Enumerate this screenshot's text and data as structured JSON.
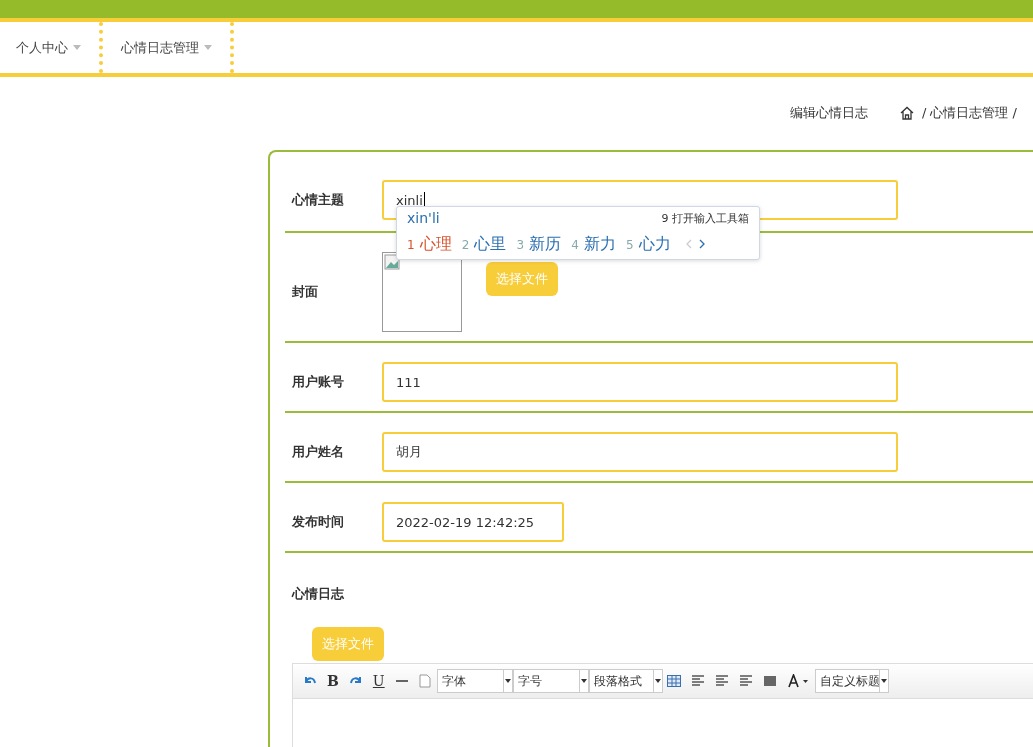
{
  "nav": [
    {
      "label": "个人中心"
    },
    {
      "label": "心情日志管理"
    }
  ],
  "breadcrumb": {
    "title": "编辑心情日志",
    "trail": "/ 心情日志管理 /"
  },
  "form": {
    "fields": [
      {
        "kind": "text",
        "label": "心情主题",
        "value": "xinli"
      },
      {
        "kind": "image",
        "label": "封面",
        "button": "选择文件"
      },
      {
        "kind": "text",
        "label": "用户账号",
        "value": "111"
      },
      {
        "kind": "text",
        "label": "用户姓名",
        "value": "胡月"
      },
      {
        "kind": "date",
        "label": "发布时间",
        "value": "2022-02-19 12:42:25"
      },
      {
        "kind": "editor",
        "label": "心情日志",
        "button": "选择文件",
        "marks": [
          "B",
          "U"
        ],
        "selects": [
          "字体",
          "字号",
          "段落格式",
          "自定义标题"
        ]
      }
    ]
  },
  "ime": {
    "composition": "xin'li",
    "toolbox": "9 打开输入工具箱",
    "candidates": [
      {
        "index": "1",
        "text": "心理",
        "selected": true
      },
      {
        "index": "2",
        "text": "心里",
        "selected": false
      },
      {
        "index": "3",
        "text": "新历",
        "selected": false
      },
      {
        "index": "4",
        "text": "新力",
        "selected": false
      },
      {
        "index": "5",
        "text": "心力",
        "selected": false
      }
    ]
  }
}
